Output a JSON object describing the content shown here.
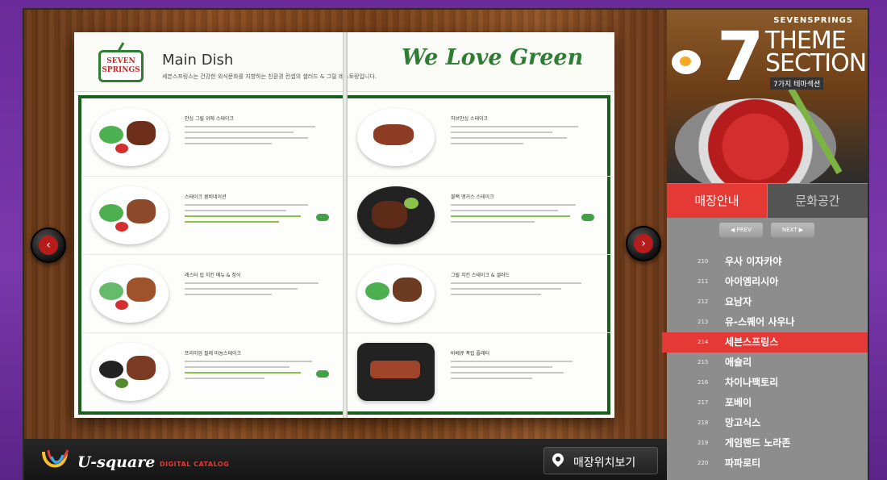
{
  "book": {
    "brand_logo_text": "SEVEN SPRINGS",
    "title": "Main Dish",
    "subtitle": "세븐스프링스는 건강한 외식문화를 지향하는 친환경 컨셉의 샐러드 & 그릴 레스토랑입니다.",
    "headline": "We Love Green"
  },
  "menu_left": [
    {
      "name": "안심 그릴 위에 스테이크"
    },
    {
      "name": "스테이크 콤비네이션"
    },
    {
      "name": "레스터 립 치킨 메뉴 & 정식"
    },
    {
      "name": "프리미엄 필레 미뇽스테이크"
    }
  ],
  "menu_right": [
    {
      "name": "허브안심 스테이크"
    },
    {
      "name": "블랙 앵거스 스테이크"
    },
    {
      "name": "그릴 치킨 스테이크 & 샐러드"
    },
    {
      "name": "바베큐 폭립 플래터"
    }
  ],
  "footer": {
    "brand": "U-square",
    "catalog": "DIGITAL CATALOG",
    "location_button": "매장위치보기"
  },
  "promo": {
    "brand": "SEVENSPRINGS",
    "number": "7",
    "line1": "THEME",
    "line2": "SECTION",
    "tag": "7가지 테마섹션"
  },
  "tabs": {
    "active": "매장안내",
    "inactive": "문화공간"
  },
  "pager": {
    "prev": "PREV",
    "next": "NEXT"
  },
  "shops": [
    {
      "num": "210",
      "name": "우사 이자카야"
    },
    {
      "num": "211",
      "name": "아이엠리시아"
    },
    {
      "num": "212",
      "name": "요남자"
    },
    {
      "num": "213",
      "name": "유-스퀘어 사우나"
    },
    {
      "num": "214",
      "name": "세븐스프링스",
      "active": true
    },
    {
      "num": "215",
      "name": "애슐리"
    },
    {
      "num": "216",
      "name": "차이나팩토리"
    },
    {
      "num": "217",
      "name": "포베이"
    },
    {
      "num": "218",
      "name": "망고식스"
    },
    {
      "num": "219",
      "name": "게임랜드 노라존"
    },
    {
      "num": "220",
      "name": "파파로티"
    }
  ],
  "colors": {
    "accent_red": "#e53935",
    "brand_green": "#2e7d32",
    "background_purple": "#6b2a9a"
  }
}
